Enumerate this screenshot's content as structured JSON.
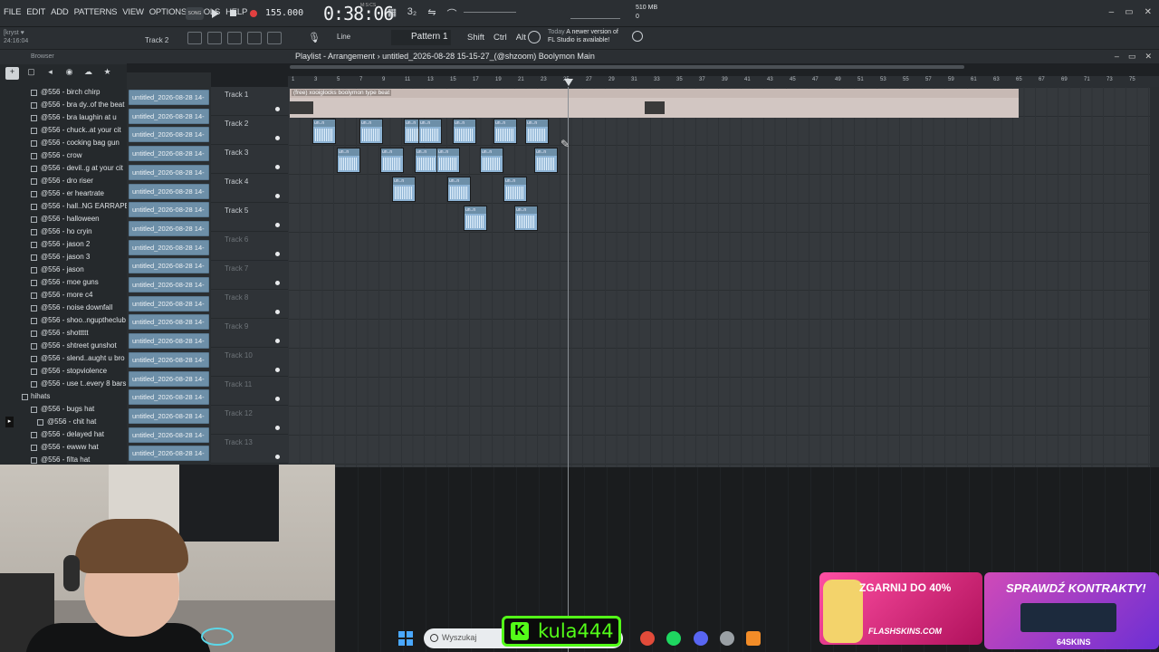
{
  "menu": {
    "items": [
      "FILE",
      "EDIT",
      "ADD",
      "PATTERNS",
      "VIEW",
      "OPTIONS",
      "TOOLS",
      "HELP"
    ]
  },
  "transport": {
    "song_badge": "SONG",
    "tempo": "155.000",
    "time": "0:38:06",
    "time_unit": "M:S:CS"
  },
  "system": {
    "memory": "510 MB",
    "voices": "0",
    "cpu": "2"
  },
  "status": {
    "user_hint": "[kryst ♥",
    "user_time": "24:16:04",
    "track_hint": "Track 2"
  },
  "toolbar": {
    "line_label": "Line",
    "pattern": "Pattern 1",
    "shift": "Shift",
    "ctrl": "Ctrl",
    "alt": "Alt",
    "news_day": "Today",
    "news_line1": "A newer version of",
    "news_line2": "FL Studio is available!"
  },
  "browser": {
    "title": "Browser",
    "items": [
      "@556 - birch chirp",
      "@556 - bra dy..of the beat",
      "@556 - bra laughin at u",
      "@556 - chuck..at your cit",
      "@556 - cocking bag gun",
      "@556 - crow",
      "@556 - devil..g at your cit",
      "@556 - dro riser",
      "@556 - er heartrate",
      "@556 - hall..NG EARRAPE)",
      "@556 - halloween",
      "@556 - ho cryin",
      "@556 - jason 2",
      "@556 - jason 3",
      "@556 - jason",
      "@556 - moe guns",
      "@556 - more c4",
      "@556 - noise downfall",
      "@556 - shoo..nguptheclub",
      "@556 - shottttt",
      "@556 - shtreet gunshot",
      "@556 - slend..aught u bro",
      "@556 - stopviolence",
      "@556 - use t..every 8 bars"
    ],
    "folder": "hihats",
    "items2": [
      "@556 - bugs hat",
      "@556 - chit hat",
      "@556 - delayed hat",
      "@556 - ewww hat",
      "@556 - filta hat"
    ]
  },
  "clips": {
    "label": "untitled_2026-08-28 14-",
    "count": 20
  },
  "playlist": {
    "title": "Playlist - Arrangement",
    "breadcrumb": "untitled_2026-08-28 15-15-27_(@shzoom) Boolymon Main",
    "tracks": [
      "Track 1",
      "Track 2",
      "Track 3",
      "Track 4",
      "Track 5",
      "Track 6",
      "Track 7",
      "Track 8",
      "Track 9",
      "Track 10",
      "Track 11",
      "Track 12",
      "Track 13"
    ],
    "ruler": [
      "1",
      "3",
      "5",
      "7",
      "9",
      "11",
      "13",
      "15",
      "17",
      "19",
      "21",
      "23",
      "25",
      "27",
      "29",
      "31",
      "33",
      "35",
      "37",
      "39",
      "41",
      "43",
      "45",
      "47",
      "49",
      "51",
      "53",
      "55",
      "57",
      "59",
      "61",
      "63",
      "65",
      "67",
      "69",
      "71",
      "73",
      "75"
    ],
    "audio_clip_label": "(free) xooiglocks boolymon type beat",
    "mini_clip_label": "un..n"
  },
  "taskbar": {
    "search_placeholder": "Wyszukaj"
  },
  "overlay": {
    "kick_name": "kula444",
    "ad1_head": "ZGARNIJ DO 40%",
    "ad1_foot": "FLASHSKINS.COM",
    "ad2_head": "SPRAWDŹ KONTRAKTY!",
    "ad2_foot": "64SKINS"
  }
}
